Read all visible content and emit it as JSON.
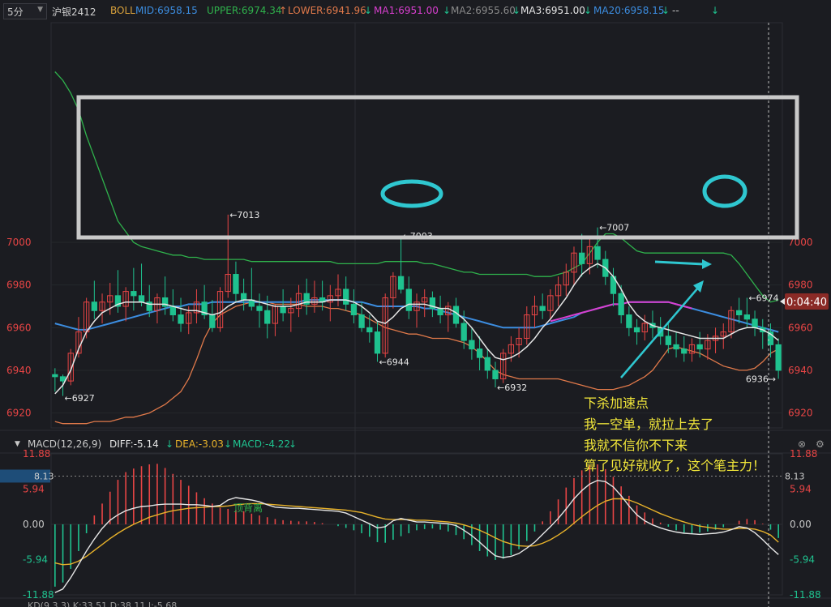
{
  "header": {
    "period": "5分",
    "symbol": "沪银2412",
    "boll": "BOLL",
    "mid": "MID:6958.15",
    "upper": "UPPER:6974.34",
    "lower": "LOWER:6941.96",
    "ma1": "MA1:6951.00",
    "ma2": "MA2:6955.60",
    "ma3": "MA3:6951.00",
    "ma20": "MA20:6958.15",
    "tail": "--"
  },
  "price_axis": {
    "ticks": [
      "7000",
      "6980",
      "6960",
      "6940",
      "6920"
    ],
    "range": [
      6913,
      7103
    ]
  },
  "price_label": "0:04:40",
  "marks": [
    {
      "text": "←7013",
      "value": 7013,
      "idx": 22
    },
    {
      "text": "←7003",
      "value": 7003,
      "idx": 44
    },
    {
      "text": "←7007",
      "value": 7007,
      "idx": 69
    },
    {
      "text": "←6974",
      "value": 6974,
      "idx": 88
    },
    {
      "text": "←6944",
      "value": 6944,
      "idx": 41
    },
    {
      "text": "←6932",
      "value": 6932,
      "idx": 56
    },
    {
      "text": "←6927",
      "value": 6927,
      "idx": 1
    },
    {
      "text": "6936→",
      "value": 6936,
      "idx": 92
    }
  ],
  "macd": {
    "title": "MACD(12,26,9)",
    "diff": "DIFF:-5.14",
    "dea": "DEA:-3.03",
    "macd": "MACD:-4.22",
    "ticks": [
      "11.88",
      "5.94",
      "0.00",
      "-5.94",
      "-11.88"
    ],
    "current": "8.13",
    "range": [
      -11.88,
      11.88
    ]
  },
  "annotations": {
    "lines": [
      "下杀加速点",
      "我一空单，就拉上去了",
      "我就不信你不下来",
      "算了见好就收了，这个笔主力！"
    ],
    "divergence": "顶背离"
  },
  "bottom_partial": "KD(9,3,3)  K:33.51  D:38.11  J:-5.68",
  "colors": {
    "up": "#e84545",
    "down": "#1fc28f",
    "mid": "#3c8de0",
    "upper": "#2fb24c",
    "lower": "#e0794a",
    "ma": "#e6e6e6",
    "ma20": "#d93fd0",
    "dea": "#e8b22a",
    "accent_box": "#c9c9c9",
    "ellipse": "#2fc7d0"
  },
  "chart_data": {
    "type": "candlestick",
    "title": "沪银2412 5分",
    "ohlc": [
      [
        6938,
        6941,
        6930,
        6937
      ],
      [
        6937,
        6938,
        6928,
        6935
      ],
      [
        6935,
        6950,
        6933,
        6948
      ],
      [
        6948,
        6965,
        6946,
        6958
      ],
      [
        6958,
        6974,
        6955,
        6972
      ],
      [
        6972,
        6982,
        6964,
        6968
      ],
      [
        6968,
        6976,
        6962,
        6972
      ],
      [
        6972,
        6981,
        6966,
        6975
      ],
      [
        6975,
        6987,
        6967,
        6970
      ],
      [
        6970,
        6979,
        6963,
        6977
      ],
      [
        6977,
        6988,
        6968,
        6975
      ],
      [
        6975,
        6990,
        6970,
        6972
      ],
      [
        6972,
        6980,
        6965,
        6968
      ],
      [
        6968,
        6976,
        6962,
        6974
      ],
      [
        6974,
        6984,
        6966,
        6970
      ],
      [
        6970,
        6978,
        6963,
        6966
      ],
      [
        6966,
        6974,
        6958,
        6962
      ],
      [
        6962,
        6970,
        6957,
        6967
      ],
      [
        6967,
        6978,
        6962,
        6972
      ],
      [
        6972,
        6980,
        6964,
        6966
      ],
      [
        6966,
        6973,
        6958,
        6960
      ],
      [
        6960,
        6979,
        6958,
        6977
      ],
      [
        6977,
        7013,
        6974,
        6985
      ],
      [
        6985,
        6991,
        6972,
        6976
      ],
      [
        6976,
        6983,
        6968,
        6973
      ],
      [
        6973,
        6988,
        6968,
        6970
      ],
      [
        6970,
        6976,
        6960,
        6968
      ],
      [
        6968,
        6975,
        6955,
        6962
      ],
      [
        6962,
        6971,
        6956,
        6970
      ],
      [
        6970,
        6978,
        6963,
        6967
      ],
      [
        6967,
        6974,
        6958,
        6969
      ],
      [
        6969,
        6980,
        6965,
        6976
      ],
      [
        6976,
        6983,
        6966,
        6971
      ],
      [
        6971,
        6982,
        6967,
        6974
      ],
      [
        6974,
        6982,
        6968,
        6972
      ],
      [
        6972,
        6980,
        6963,
        6975
      ],
      [
        6975,
        6985,
        6970,
        6978
      ],
      [
        6978,
        6984,
        6968,
        6971
      ],
      [
        6971,
        6978,
        6962,
        6966
      ],
      [
        6966,
        6972,
        6958,
        6960
      ],
      [
        6960,
        6966,
        6953,
        6958
      ],
      [
        6958,
        6963,
        6944,
        6948
      ],
      [
        6948,
        6976,
        6946,
        6974
      ],
      [
        6974,
        6986,
        6969,
        6984
      ],
      [
        6984,
        7003,
        6976,
        6978
      ],
      [
        6978,
        6984,
        6964,
        6968
      ],
      [
        6968,
        6976,
        6960,
        6972
      ],
      [
        6972,
        6978,
        6965,
        6974
      ],
      [
        6974,
        6977,
        6965,
        6969
      ],
      [
        6969,
        6975,
        6962,
        6966
      ],
      [
        6966,
        6972,
        6958,
        6970
      ],
      [
        6970,
        6974,
        6960,
        6962
      ],
      [
        6962,
        6968,
        6950,
        6954
      ],
      [
        6954,
        6960,
        6945,
        6950
      ],
      [
        6950,
        6956,
        6940,
        6946
      ],
      [
        6946,
        6950,
        6936,
        6940
      ],
      [
        6940,
        6944,
        6932,
        6936
      ],
      [
        6936,
        6950,
        6934,
        6948
      ],
      [
        6948,
        6956,
        6944,
        6952
      ],
      [
        6952,
        6960,
        6946,
        6955
      ],
      [
        6955,
        6970,
        6952,
        6966
      ],
      [
        6966,
        6975,
        6960,
        6970
      ],
      [
        6970,
        6976,
        6964,
        6968
      ],
      [
        6968,
        6978,
        6964,
        6975
      ],
      [
        6975,
        6984,
        6970,
        6980
      ],
      [
        6980,
        6990,
        6975,
        6986
      ],
      [
        6986,
        6998,
        6980,
        6995
      ],
      [
        6995,
        7004,
        6984,
        6990
      ],
      [
        6990,
        7002,
        6985,
        6998
      ],
      [
        6998,
        7007,
        6988,
        6992
      ],
      [
        6992,
        6996,
        6980,
        6984
      ],
      [
        6984,
        6988,
        6970,
        6976
      ],
      [
        6976,
        6980,
        6962,
        6966
      ],
      [
        6966,
        6970,
        6956,
        6960
      ],
      [
        6960,
        6964,
        6952,
        6958
      ],
      [
        6958,
        6966,
        6954,
        6962
      ],
      [
        6962,
        6968,
        6955,
        6960
      ],
      [
        6960,
        6965,
        6952,
        6956
      ],
      [
        6956,
        6962,
        6948,
        6952
      ],
      [
        6952,
        6958,
        6946,
        6950
      ],
      [
        6950,
        6956,
        6944,
        6948
      ],
      [
        6948,
        6955,
        6944,
        6952
      ],
      [
        6952,
        6958,
        6946,
        6950
      ],
      [
        6950,
        6957,
        6945,
        6954
      ],
      [
        6954,
        6960,
        6948,
        6956
      ],
      [
        6956,
        6962,
        6950,
        6958
      ],
      [
        6958,
        6970,
        6955,
        6968
      ],
      [
        6968,
        6974,
        6962,
        6966
      ],
      [
        6966,
        6974,
        6960,
        6964
      ],
      [
        6964,
        6968,
        6956,
        6960
      ],
      [
        6960,
        6964,
        6950,
        6958
      ],
      [
        6958,
        6962,
        6946,
        6952
      ],
      [
        6952,
        6955,
        6936,
        6940
      ]
    ],
    "ma_line": [
      6929,
      6933,
      6940,
      6950,
      6958,
      6963,
      6967,
      6969,
      6971,
      6972,
      6972,
      6972,
      6971,
      6971,
      6971,
      6970,
      6969,
      6968,
      6968,
      6967,
      6966,
      6967,
      6970,
      6972,
      6973,
      6973,
      6972,
      6971,
      6970,
      6970,
      6970,
      6971,
      6972,
      6972,
      6972,
      6973,
      6973,
      6973,
      6972,
      6970,
      6967,
      6963,
      6962,
      6965,
      6969,
      6971,
      6971,
      6971,
      6970,
      6969,
      6969,
      6967,
      6964,
      6960,
      6955,
      6950,
      6946,
      6945,
      6946,
      6948,
      6951,
      6955,
      6960,
      6964,
      6969,
      6974,
      6980,
      6985,
      6988,
      6990,
      6988,
      6984,
      6978,
      6971,
      6966,
      6963,
      6961,
      6960,
      6959,
      6958,
      6957,
      6956,
      6955,
      6955,
      6955,
      6955,
      6957,
      6959,
      6960,
      6960,
      6959,
      6957,
      6954
    ],
    "mid_line": [
      6962,
      6961,
      6960,
      6959,
      6959,
      6960,
      6961,
      6962,
      6963,
      6964,
      6965,
      6966,
      6967,
      6968,
      6969,
      6970,
      6970,
      6971,
      6971,
      6971,
      6972,
      6972,
      6972,
      6972,
      6972,
      6972,
      6972,
      6972,
      6972,
      6972,
      6972,
      6972,
      6973,
      6973,
      6973,
      6973,
      6973,
      6973,
      6972,
      6972,
      6971,
      6970,
      6970,
      6970,
      6970,
      6970,
      6970,
      6969,
      6969,
      6968,
      6967,
      6966,
      6965,
      6964,
      6963,
      6962,
      6961,
      6960,
      6960,
      6960,
      6960,
      6960,
      6961,
      6962,
      6963,
      6964,
      6965,
      6967,
      6968,
      6969,
      6970,
      6971,
      6971,
      6972,
      6972,
      6972,
      6972,
      6972,
      6972,
      6971,
      6970,
      6969,
      6968,
      6967,
      6966,
      6965,
      6964,
      6963,
      6962,
      6961,
      6960,
      6959,
      6958
    ],
    "upper_line": [
      7080,
      7076,
      7070,
      7062,
      7050,
      7040,
      7030,
      7020,
      7010,
      7005,
      7000,
      6998,
      6997,
      6996,
      6995,
      6994,
      6994,
      6993,
      6993,
      6992,
      6992,
      6992,
      6992,
      6992,
      6992,
      6991,
      6991,
      6991,
      6991,
      6991,
      6991,
      6991,
      6991,
      6991,
      6991,
      6991,
      6990,
      6990,
      6990,
      6990,
      6990,
      6990,
      6991,
      6991,
      6991,
      6991,
      6991,
      6990,
      6990,
      6989,
      6988,
      6987,
      6986,
      6986,
      6985,
      6985,
      6985,
      6985,
      6985,
      6985,
      6985,
      6984,
      6984,
      6984,
      6985,
      6986,
      6988,
      6990,
      6995,
      7000,
      7004,
      7004,
      7002,
      6999,
      6996,
      6995,
      6995,
      6995,
      6995,
      6995,
      6995,
      6995,
      6995,
      6995,
      6995,
      6995,
      6994,
      6990,
      6985,
      6980,
      6975,
      6972,
      6973
    ],
    "lower_line": [
      6916,
      6915,
      6915,
      6915,
      6915,
      6916,
      6916,
      6916,
      6917,
      6918,
      6918,
      6919,
      6920,
      6922,
      6924,
      6927,
      6930,
      6936,
      6945,
      6955,
      6962,
      6966,
      6968,
      6970,
      6971,
      6972,
      6972,
      6972,
      6971,
      6971,
      6971,
      6971,
      6970,
      6970,
      6970,
      6969,
      6969,
      6968,
      6967,
      6966,
      6964,
      6962,
      6960,
      6959,
      6958,
      6957,
      6957,
      6956,
      6955,
      6955,
      6955,
      6954,
      6953,
      6951,
      6948,
      6944,
      6940,
      6938,
      6937,
      6936,
      6936,
      6936,
      6936,
      6936,
      6936,
      6935,
      6934,
      6933,
      6932,
      6931,
      6931,
      6931,
      6932,
      6933,
      6935,
      6937,
      6940,
      6945,
      6950,
      6951,
      6950,
      6949,
      6948,
      6946,
      6944,
      6942,
      6941,
      6940,
      6940,
      6941,
      6944,
      6948,
      6950
    ],
    "ma20_line": [
      null,
      null,
      null,
      null,
      null,
      null,
      null,
      null,
      null,
      null,
      null,
      null,
      null,
      null,
      null,
      null,
      null,
      null,
      null,
      null,
      null,
      null,
      null,
      null,
      null,
      null,
      null,
      null,
      null,
      null,
      null,
      null,
      null,
      null,
      null,
      null,
      null,
      null,
      null,
      null,
      null,
      null,
      null,
      null,
      null,
      null,
      null,
      null,
      null,
      null,
      null,
      null,
      null,
      null,
      null,
      null,
      null,
      null,
      null,
      null,
      null,
      null,
      null,
      6963,
      6964,
      6965,
      6966,
      6967,
      6968,
      6969,
      6970,
      6971,
      6971,
      6972,
      6972,
      6972,
      6972,
      6972,
      6972,
      6971,
      6970,
      6969,
      null,
      null,
      null,
      null,
      null,
      null,
      null,
      null,
      null,
      null,
      null
    ],
    "macd_hist": [
      -10.5,
      -9.8,
      -7.5,
      -4.5,
      -1.5,
      1.5,
      3.5,
      5.5,
      7.5,
      8.8,
      9.4,
      9.8,
      10.1,
      10.2,
      9.5,
      8.5,
      7.5,
      6.5,
      5.4,
      4.4,
      3.5,
      2.8,
      2.6,
      2.4,
      2.2,
      1.8,
      1.5,
      1.2,
      0.9,
      0.7,
      0.6,
      0.5,
      0.5,
      0.4,
      0.2,
      0,
      -0.3,
      -0.6,
      -1.0,
      -1.5,
      -2.1,
      -3.0,
      -3.1,
      -2.6,
      -2.0,
      -1.5,
      -1.0,
      -0.8,
      -0.7,
      -0.9,
      -1.2,
      -1.8,
      -2.5,
      -3.5,
      -4.5,
      -5.4,
      -6.0,
      -5.8,
      -5.2,
      -4.2,
      -2.8,
      -1.2,
      0.5,
      2.2,
      4.2,
      6.2,
      7.8,
      9.1,
      9.9,
      10.1,
      9.3,
      8.0,
      6.4,
      4.8,
      3.2,
      2.0,
      1.0,
      0.3,
      -0.4,
      -1.0,
      -1.4,
      -1.5,
      -1.4,
      -1.2,
      -0.9,
      -0.5,
      0,
      0.6,
      0.9,
      0.7,
      0.1,
      -0.9,
      -2.3
    ],
    "diff_line": [
      -11.5,
      -10.9,
      -9.0,
      -6.8,
      -4.5,
      -2.5,
      -0.7,
      0.7,
      1.6,
      2.3,
      2.7,
      3.0,
      3.1,
      3.3,
      3.4,
      3.4,
      3.4,
      3.3,
      3.3,
      3.2,
      3.0,
      3.2,
      4.1,
      4.5,
      4.3,
      4.1,
      3.8,
      3.3,
      2.9,
      2.8,
      2.7,
      2.7,
      2.6,
      2.5,
      2.4,
      2.3,
      2.2,
      1.9,
      1.3,
      0.7,
      0.1,
      -0.6,
      -0.4,
      0.6,
      1.0,
      0.7,
      0.4,
      0.4,
      0.3,
      0.2,
      0.1,
      -0.2,
      -1.0,
      -1.9,
      -3.0,
      -4.2,
      -5.3,
      -5.6,
      -5.4,
      -4.9,
      -4.0,
      -3.0,
      -1.7,
      -0.4,
      1.0,
      2.6,
      4.3,
      5.7,
      6.8,
      7.4,
      7.2,
      6.3,
      4.8,
      3.1,
      1.6,
      0.6,
      -0.1,
      -0.6,
      -1.0,
      -1.3,
      -1.5,
      -1.6,
      -1.7,
      -1.6,
      -1.5,
      -1.3,
      -0.9,
      -0.4,
      -0.6,
      -1.4,
      -2.6,
      -3.9,
      -5.1
    ],
    "dea_line": [
      -6.5,
      -6.8,
      -6.7,
      -6.2,
      -5.4,
      -4.4,
      -3.4,
      -2.4,
      -1.5,
      -0.7,
      0.0,
      0.6,
      1.2,
      1.6,
      2.0,
      2.3,
      2.5,
      2.7,
      2.8,
      2.9,
      3.0,
      3.0,
      3.1,
      3.3,
      3.4,
      3.5,
      3.5,
      3.4,
      3.3,
      3.2,
      3.1,
      3.0,
      2.9,
      2.8,
      2.7,
      2.6,
      2.5,
      2.4,
      2.2,
      2.0,
      1.6,
      1.2,
      0.9,
      0.8,
      0.8,
      0.8,
      0.7,
      0.7,
      0.6,
      0.5,
      0.4,
      0.2,
      -0.1,
      -0.5,
      -1.0,
      -1.6,
      -2.3,
      -2.9,
      -3.3,
      -3.6,
      -3.7,
      -3.6,
      -3.2,
      -2.6,
      -1.8,
      -0.9,
      0.2,
      1.3,
      2.3,
      3.2,
      3.9,
      4.3,
      4.3,
      4.1,
      3.6,
      3.0,
      2.4,
      1.8,
      1.3,
      0.8,
      0.4,
      0.0,
      -0.3,
      -0.5,
      -0.7,
      -0.8,
      -0.8,
      -0.7,
      -0.7,
      -0.8,
      -1.2,
      -1.8,
      -3.0
    ]
  }
}
